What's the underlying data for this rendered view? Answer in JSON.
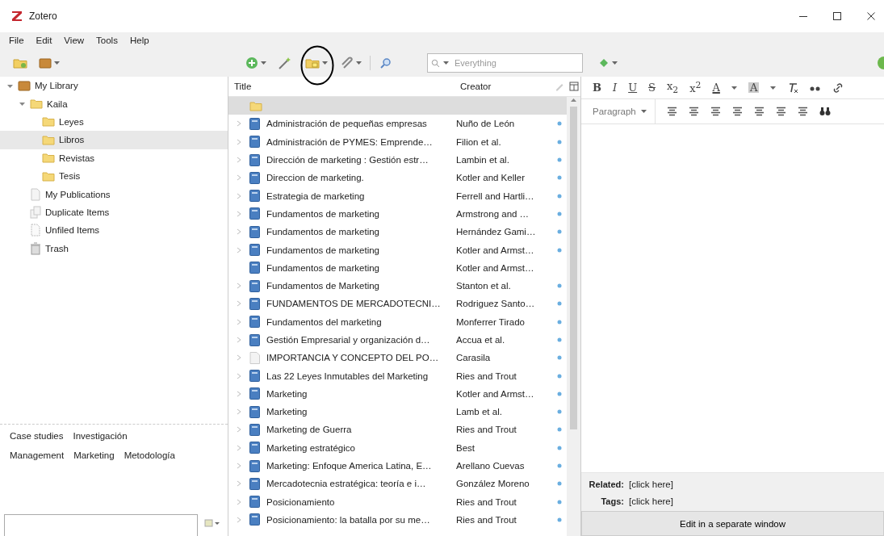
{
  "window": {
    "title": "Zotero"
  },
  "menu": [
    "File",
    "Edit",
    "View",
    "Tools",
    "Help"
  ],
  "search": {
    "placeholder": "Everything"
  },
  "collections": [
    {
      "label": "My Library",
      "kind": "library",
      "expanded": true,
      "selected": false,
      "children": [
        {
          "label": "Kaila",
          "kind": "folder",
          "expanded": true,
          "selected": false,
          "children": [
            {
              "label": "Leyes",
              "kind": "folder",
              "selected": false
            },
            {
              "label": "Libros",
              "kind": "folder",
              "selected": true
            },
            {
              "label": "Revistas",
              "kind": "folder",
              "selected": false
            },
            {
              "label": "Tesis",
              "kind": "folder",
              "selected": false
            }
          ]
        },
        {
          "label": "My Publications",
          "kind": "publications",
          "selected": false
        },
        {
          "label": "Duplicate Items",
          "kind": "duplicates",
          "selected": false
        },
        {
          "label": "Unfiled Items",
          "kind": "unfiled",
          "selected": false
        },
        {
          "label": "Trash",
          "kind": "trash",
          "selected": false
        }
      ]
    }
  ],
  "tag_rows": [
    {
      "tags": [
        "Case studies",
        "Investigación"
      ]
    },
    {
      "tags": [
        "Management",
        "Marketing",
        "Metodología"
      ]
    }
  ],
  "items": {
    "columns": [
      "Title",
      "Creator"
    ],
    "rows": [
      {
        "kind": "folder",
        "selected": true,
        "has_children": false,
        "attachment": false
      },
      {
        "kind": "book",
        "title": "Administración de pequeñas empresas",
        "creator": "Nuño de León",
        "selected": false,
        "has_children": true,
        "attachment": true
      },
      {
        "kind": "book",
        "title": "Administración de PYMES: Emprende…",
        "creator": "Filion et al.",
        "selected": false,
        "has_children": true,
        "attachment": true
      },
      {
        "kind": "book",
        "title": "Dirección de marketing : Gestión estr…",
        "creator": "Lambin et al.",
        "selected": false,
        "has_children": true,
        "attachment": true
      },
      {
        "kind": "book",
        "title": "Direccion de marketing.",
        "creator": "Kotler and Keller",
        "selected": false,
        "has_children": true,
        "attachment": true
      },
      {
        "kind": "book",
        "title": "Estrategia de marketing",
        "creator": "Ferrell and Hartli…",
        "selected": false,
        "has_children": true,
        "attachment": true
      },
      {
        "kind": "book",
        "title": "Fundamentos de marketing",
        "creator": "Armstrong and …",
        "selected": false,
        "has_children": true,
        "attachment": true
      },
      {
        "kind": "book",
        "title": "Fundamentos de marketing",
        "creator": "Hernández Gami…",
        "selected": false,
        "has_children": true,
        "attachment": true
      },
      {
        "kind": "book",
        "title": "Fundamentos de marketing",
        "creator": "Kotler and Armst…",
        "selected": false,
        "has_children": true,
        "attachment": true
      },
      {
        "kind": "book",
        "title": "Fundamentos de marketing",
        "creator": "Kotler and Armst…",
        "selected": false,
        "has_children": false,
        "attachment": false
      },
      {
        "kind": "book",
        "title": "Fundamentos de Marketing",
        "creator": "Stanton et al.",
        "selected": false,
        "has_children": true,
        "attachment": true
      },
      {
        "kind": "book",
        "title": "FUNDAMENTOS DE MERCADOTECNI…",
        "creator": "Rodriguez Santo…",
        "selected": false,
        "has_children": true,
        "attachment": true
      },
      {
        "kind": "book",
        "title": "Fundamentos del marketing",
        "creator": "Monferrer Tirado",
        "selected": false,
        "has_children": true,
        "attachment": true
      },
      {
        "kind": "book",
        "title": "Gestión Empresarial y organización d…",
        "creator": "Accua et al.",
        "selected": false,
        "has_children": true,
        "attachment": true
      },
      {
        "kind": "document",
        "title": "IMPORTANCIA Y CONCEPTO DEL PO…",
        "creator": "Carasila",
        "selected": false,
        "has_children": true,
        "attachment": true
      },
      {
        "kind": "book",
        "title": "Las 22 Leyes Inmutables del Marketing",
        "creator": "Ries and Trout",
        "selected": false,
        "has_children": true,
        "attachment": true
      },
      {
        "kind": "book",
        "title": "Marketing",
        "creator": "Kotler and Armst…",
        "selected": false,
        "has_children": true,
        "attachment": true
      },
      {
        "kind": "book",
        "title": "Marketing",
        "creator": "Lamb et al.",
        "selected": false,
        "has_children": true,
        "attachment": true
      },
      {
        "kind": "book",
        "title": "Marketing de Guerra",
        "creator": "Ries and Trout",
        "selected": false,
        "has_children": true,
        "attachment": true
      },
      {
        "kind": "book",
        "title": "Marketing estratégico",
        "creator": "Best",
        "selected": false,
        "has_children": true,
        "attachment": true
      },
      {
        "kind": "book",
        "title": "Marketing: Enfoque America Latina, E…",
        "creator": "Arellano Cuevas",
        "selected": false,
        "has_children": true,
        "attachment": true
      },
      {
        "kind": "book",
        "title": "Mercadotecnia estratégica: teoría e i…",
        "creator": "González Moreno",
        "selected": false,
        "has_children": true,
        "attachment": true
      },
      {
        "kind": "book",
        "title": "Posicionamiento",
        "creator": "Ries and Trout",
        "selected": false,
        "has_children": true,
        "attachment": true
      },
      {
        "kind": "book",
        "title": "Posicionamiento: la batalla por su me…",
        "creator": "Ries and Trout",
        "selected": false,
        "has_children": true,
        "attachment": true
      }
    ]
  },
  "editor": {
    "format_buttons": [
      {
        "kind": "bold",
        "label": "B"
      },
      {
        "kind": "italic",
        "label": "I"
      },
      {
        "kind": "underline",
        "label": "U"
      },
      {
        "kind": "strike",
        "label": "S"
      },
      {
        "kind": "subscript",
        "label": "x$_{2}$"
      },
      {
        "kind": "superscript",
        "label": "x$^{2}$"
      },
      {
        "kind": "text-color",
        "label": "A"
      },
      {
        "kind": "highlight",
        "label": "A"
      }
    ],
    "paragraph_format": "Paragraph"
  },
  "note_footer": {
    "related_label": "Related:",
    "related_value": "[click here]",
    "tags_label": "Tags:",
    "tags_value": "[click here]",
    "button": "Edit in a separate window"
  }
}
